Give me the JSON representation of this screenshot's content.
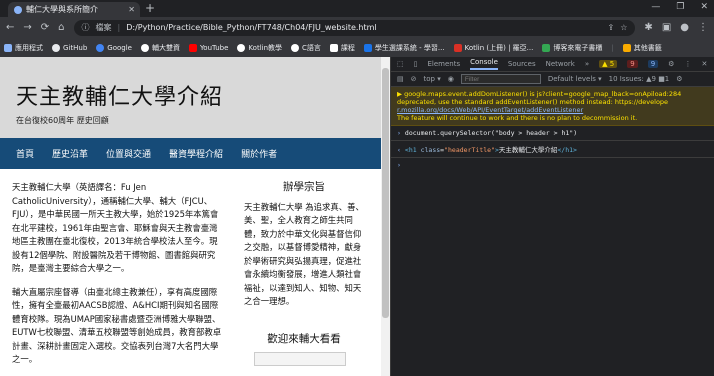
{
  "browser": {
    "tab_title": "輔仁大學與系所簡介",
    "new_tab": "+",
    "window_controls": [
      "—",
      "❐",
      "✕"
    ],
    "nav": [
      "←",
      "→",
      "⟳",
      "⌂"
    ],
    "security_label": "檔案",
    "url": "D:/Python/Practice/Bible_Python/FT748/Ch04/FJU_website.html",
    "toolbar_icons": [
      "share",
      "star",
      "extensions",
      "sidebar",
      "profile",
      "menu"
    ],
    "bookmarks": [
      {
        "label": "應用程式",
        "color": "#8ab4f8"
      },
      {
        "label": "GitHub",
        "color": "#e8eaed"
      },
      {
        "label": "Google",
        "color": "#4285f4"
      },
      {
        "label": "輔大雙資",
        "color": "#ffffff"
      },
      {
        "label": "YouTube",
        "color": "#ff0000"
      },
      {
        "label": "Kotlin教學",
        "color": "#ffffff"
      },
      {
        "label": "C語言",
        "color": "#ffffff"
      },
      {
        "label": "課程",
        "color": "#ffffff"
      },
      {
        "label": "學生選課系統 - 學習...",
        "color": "#1a73e8"
      },
      {
        "label": "Kotlin (上冊) | 羅亞...",
        "color": "#d93025"
      },
      {
        "label": "博客來電子書櫃",
        "color": "#34a853"
      }
    ],
    "bookmarks_more": "其他書籤"
  },
  "site": {
    "title": "天主教輔仁大學介紹",
    "subtitle": "在台復校60周年 歷史回顧",
    "nav": [
      "首頁",
      "歷史沿革",
      "位置與交通",
      "醫資學程介紹",
      "關於作者"
    ],
    "left_p1": "天主教輔仁大學（英語譯名：Fu Jen CatholicUniversity），通稱輔仁大學、輔大（FJCU、FJU），是中華民國一所天主教大學，始於1925年本篤會在北平建校，1961年由聖言會、耶穌會與天主教會臺灣地區主教團在臺北復校，2013年統合學校法人至今。現設有12個學院、附設醫院及若干博物館、圖書館與研究院，是臺灣主要綜合大學之一。",
    "left_p2": "輔大直屬宗座督導（由臺北總主教兼任），享有高度國際性，擁有全臺最初AACSB認證、A&HCI期刊與知名國際體育校隊。現為UMAP國家秘書處暨亞洲博雅大學聯盟、EUTW七校聯盟、清華五校聯盟等創始成員，教育部教卓計畫、深耕計畫固定入選校。交協表列台灣7大名門大學之一。",
    "right_title": "辦學宗旨",
    "right_text": "天主教輔仁大學 為追求真、善、美、聖，全人教育之師生共同體，致力於中華文化與基督信仰之交融，以基督博愛精神，獻身於學術研究與弘揚真理，促進社會永續均衡發展，增進人類社會福祉，以達到知人、知物、知天之合一理想。",
    "welcome": "歡迎來輔大看看"
  },
  "devtools": {
    "tabs": [
      "Elements",
      "Console",
      "Sources",
      "Network",
      "»"
    ],
    "active_tab": "Console",
    "warn_count": "▲ 5",
    "error_count": "9",
    "issue_count": "9",
    "context": "top ▾",
    "filter_placeholder": "Filter",
    "levels": "Default levels ▾",
    "issues": "10 Issues: ▲9 ■1",
    "warning_lines": [
      "▶ google.maps.event.addDomListener() is js?client=google_map_lback=onApiload:284",
      "deprecated, use the standard addEventListener() method instead: https://develope",
      "r.mozilla.org/docs/Web/API/EventTarget/addEventListener",
      "The feature will continue to work and there is no plan to decommission it."
    ],
    "command": "document.querySelector(\"body > header > h1\")",
    "result_tag": "h1",
    "result_attr": "class",
    "result_val": "\"headerTitle\"",
    "result_text": "天主教輔仁大學介紹",
    "result_close": "</h1>"
  }
}
